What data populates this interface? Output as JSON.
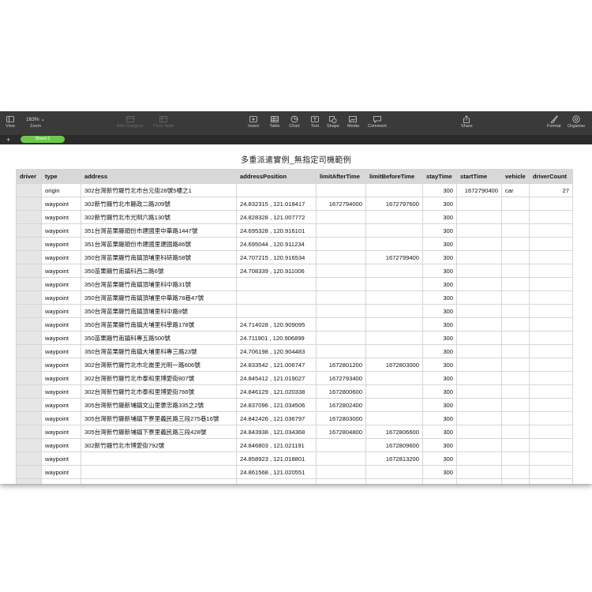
{
  "toolbar": {
    "view": "View",
    "zoom_value": "163% ⌄",
    "zoom": "Zoom",
    "add_category": "Add Category",
    "pivot_table": "Pivot Table",
    "insert": "Insert",
    "table": "Table",
    "chart": "Chart",
    "text": "Text",
    "shape": "Shape",
    "media": "Media",
    "comment": "Comment",
    "share": "Share",
    "format": "Format",
    "organise": "Organise"
  },
  "sheets": {
    "add": "+",
    "active": "Sheet 1"
  },
  "sheet_title": "多重派遣實例_無指定司機範例",
  "columns": [
    "driver",
    "type",
    "address",
    "addressPosition",
    "limitAfterTime",
    "limitBeforeTime",
    "stayTime",
    "startTime",
    "vehicle",
    "driverCount"
  ],
  "rows": [
    [
      "",
      "origin",
      "302台灣新竹縣竹北市台元街28號5樓之1",
      "",
      "",
      "",
      "300",
      "1672790400",
      "car",
      "27"
    ],
    [
      "",
      "waypoint",
      "302新竹縣竹北市縣政二路209號",
      "24.832315 , 121.018417",
      "1672794000",
      "1672797600",
      "300",
      "",
      "",
      ""
    ],
    [
      "",
      "waypoint",
      "302新竹縣竹北市光明六路130號",
      "24.828328 , 121.007772",
      "",
      "",
      "300",
      "",
      "",
      ""
    ],
    [
      "",
      "waypoint",
      "351台灣苗栗縣頭份市建國里中華路1447號",
      "24.695328 , 120.916101",
      "",
      "",
      "300",
      "",
      "",
      ""
    ],
    [
      "",
      "waypoint",
      "351台灣苗栗縣頭份市建國里建國路86號",
      "24.695044 , 120.911234",
      "",
      "",
      "300",
      "",
      "",
      ""
    ],
    [
      "",
      "waypoint",
      "350台灣苗栗縣竹南鎮頂埔里科研路58號",
      "24.707215 , 120.916534",
      "",
      "1672799400",
      "300",
      "",
      "",
      ""
    ],
    [
      "",
      "waypoint",
      "350苗栗縣竹南鎮科西二路6號",
      "24.708339 , 120.911006",
      "",
      "",
      "300",
      "",
      "",
      ""
    ],
    [
      "",
      "waypoint",
      "350台灣苗栗縣竹南鎮頂埔里科中路31號",
      "",
      "",
      "",
      "300",
      "",
      "",
      ""
    ],
    [
      "",
      "waypoint",
      "350台灣苗栗縣竹南鎮頂埔里中華路78巷47號",
      "",
      "",
      "",
      "300",
      "",
      "",
      ""
    ],
    [
      "",
      "waypoint",
      "350台灣苗栗縣竹南鎮頂埔里科中路9號",
      "",
      "",
      "",
      "300",
      "",
      "",
      ""
    ],
    [
      "",
      "waypoint",
      "350台灣苗栗縣竹南鎮大埔里科學路178號",
      "24.714028 , 120.909095",
      "",
      "",
      "300",
      "",
      "",
      ""
    ],
    [
      "",
      "waypoint",
      "350苗栗縣竹南鎮科專五路500號",
      "24.711901 , 120.906899",
      "",
      "",
      "300",
      "",
      "",
      ""
    ],
    [
      "",
      "waypoint",
      "350台灣苗栗縣竹南鎮大埔里科專三路23號",
      "24.706198 , 120.904483",
      "",
      "",
      "300",
      "",
      "",
      ""
    ],
    [
      "",
      "waypoint",
      "302台灣新竹縣竹北市北崙里光明一路606號",
      "24.833542 , 121.006747",
      "1672801200",
      "1672803000",
      "300",
      "",
      "",
      ""
    ],
    [
      "",
      "waypoint",
      "302台灣新竹縣竹北市泰和里博愛街807號",
      "24.845412 , 121.019027",
      "1672793400",
      "",
      "300",
      "",
      "",
      ""
    ],
    [
      "",
      "waypoint",
      "302台灣新竹縣竹北市泰和里博愛街766號",
      "24.846129 , 121.020338",
      "1672800600",
      "",
      "300",
      "",
      "",
      ""
    ],
    [
      "",
      "waypoint",
      "305台灣新竹縣新埔鎮文山里褒忠路335之2號",
      "24.837096 , 121.034506",
      "1672802400",
      "",
      "300",
      "",
      "",
      ""
    ],
    [
      "",
      "waypoint",
      "305台灣新竹縣新埔鎮下寮里義民路三段275巷16號",
      "24.842426 , 121.036797",
      "1672803000",
      "",
      "300",
      "",
      "",
      ""
    ],
    [
      "",
      "waypoint",
      "305台灣新竹縣新埔鎮下寮里義民路三段428號",
      "24.843938 , 121.034368",
      "1672804800",
      "1672806600",
      "300",
      "",
      "",
      ""
    ],
    [
      "",
      "waypoint",
      "302新竹縣竹北市博愛街792號",
      "24.846803 , 121.021191",
      "",
      "1672809600",
      "300",
      "",
      "",
      ""
    ],
    [
      "",
      "waypoint",
      "",
      "24.858923 , 121.018801",
      "",
      "1672813200",
      "300",
      "",
      "",
      ""
    ],
    [
      "",
      "waypoint",
      "",
      "24.861568 , 121.020551",
      "",
      "",
      "300",
      "",
      "",
      ""
    ],
    [
      "",
      "",
      "",
      "",
      "",
      "",
      "",
      "",
      "",
      ""
    ]
  ]
}
